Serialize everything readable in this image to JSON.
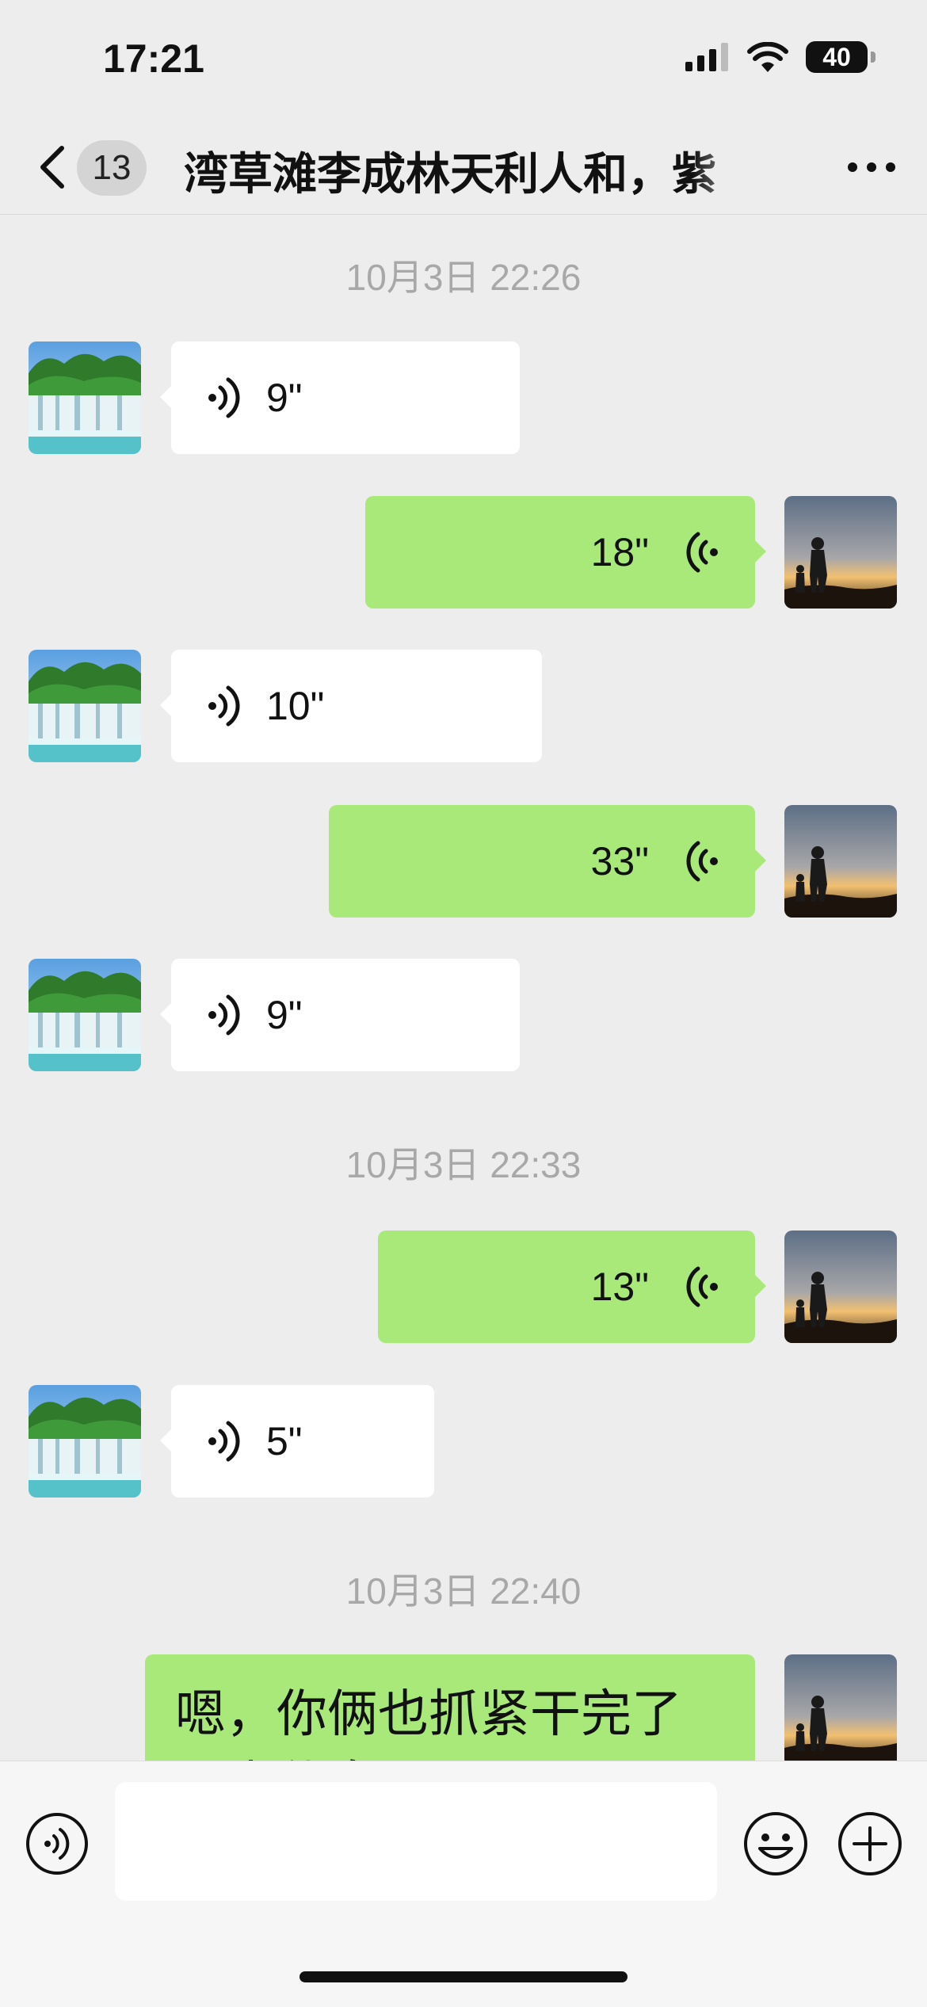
{
  "status_bar": {
    "time": "17:21",
    "battery": "40"
  },
  "nav": {
    "unread_count": "13",
    "title": "湾草滩李成林天利人和，紫"
  },
  "timestamps": [
    "10月3日 22:26",
    "10月3日 22:33",
    "10月3日 22:40"
  ],
  "messages": [
    {
      "from": "contact",
      "type": "voice",
      "duration": "9\""
    },
    {
      "from": "me",
      "type": "voice",
      "duration": "18\""
    },
    {
      "from": "contact",
      "type": "voice",
      "duration": "10\""
    },
    {
      "from": "me",
      "type": "voice",
      "duration": "33\""
    },
    {
      "from": "contact",
      "type": "voice",
      "duration": "9\""
    },
    {
      "from": "me",
      "type": "voice",
      "duration": "13\""
    },
    {
      "from": "contact",
      "type": "voice",
      "duration": "5\""
    },
    {
      "from": "me",
      "type": "text",
      "text": "嗯，你俩也抓紧干完了早点休息啊！"
    }
  ],
  "colors": {
    "sent_bubble": "#a9e97a",
    "recv_bubble": "#ffffff",
    "background": "#ededed"
  }
}
